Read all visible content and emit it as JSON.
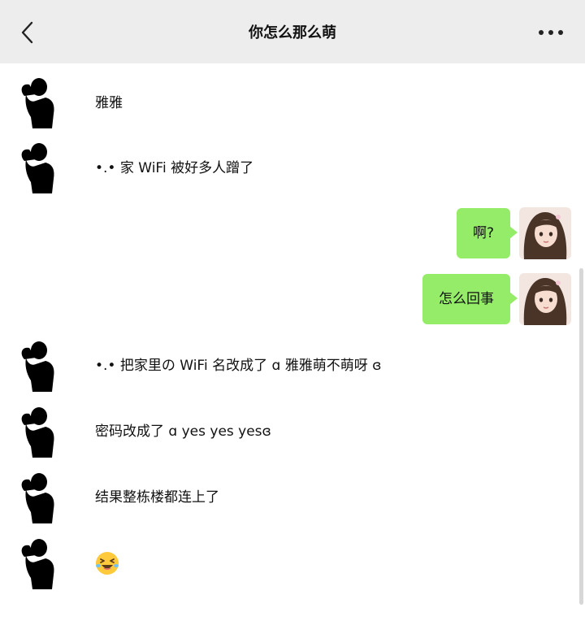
{
  "header": {
    "title": "你怎么那么萌",
    "back_icon": "chevron-left-icon",
    "more_icon": "more-horizontal-icon",
    "background": "#ededed"
  },
  "messages": [
    {
      "side": "left",
      "text": "雅雅"
    },
    {
      "side": "left",
      "text": "•.• 家 WiFi 被好多人蹭了"
    },
    {
      "side": "right",
      "text": "啊?"
    },
    {
      "side": "right",
      "text": "怎么回事"
    },
    {
      "side": "left",
      "text": "•.• 把家里の WiFi 名改成了 ɑ 雅雅萌不萌呀 ɞ"
    },
    {
      "side": "left",
      "text": "密码改成了 ɑ  yes yes yesɞ"
    },
    {
      "side": "left",
      "text": "结果整栋楼都连上了"
    },
    {
      "side": "left",
      "emoji": "laughing-squint-emoji"
    }
  ],
  "colors": {
    "bubble_self": "#95ec69",
    "chat_background": "#ffffff"
  }
}
